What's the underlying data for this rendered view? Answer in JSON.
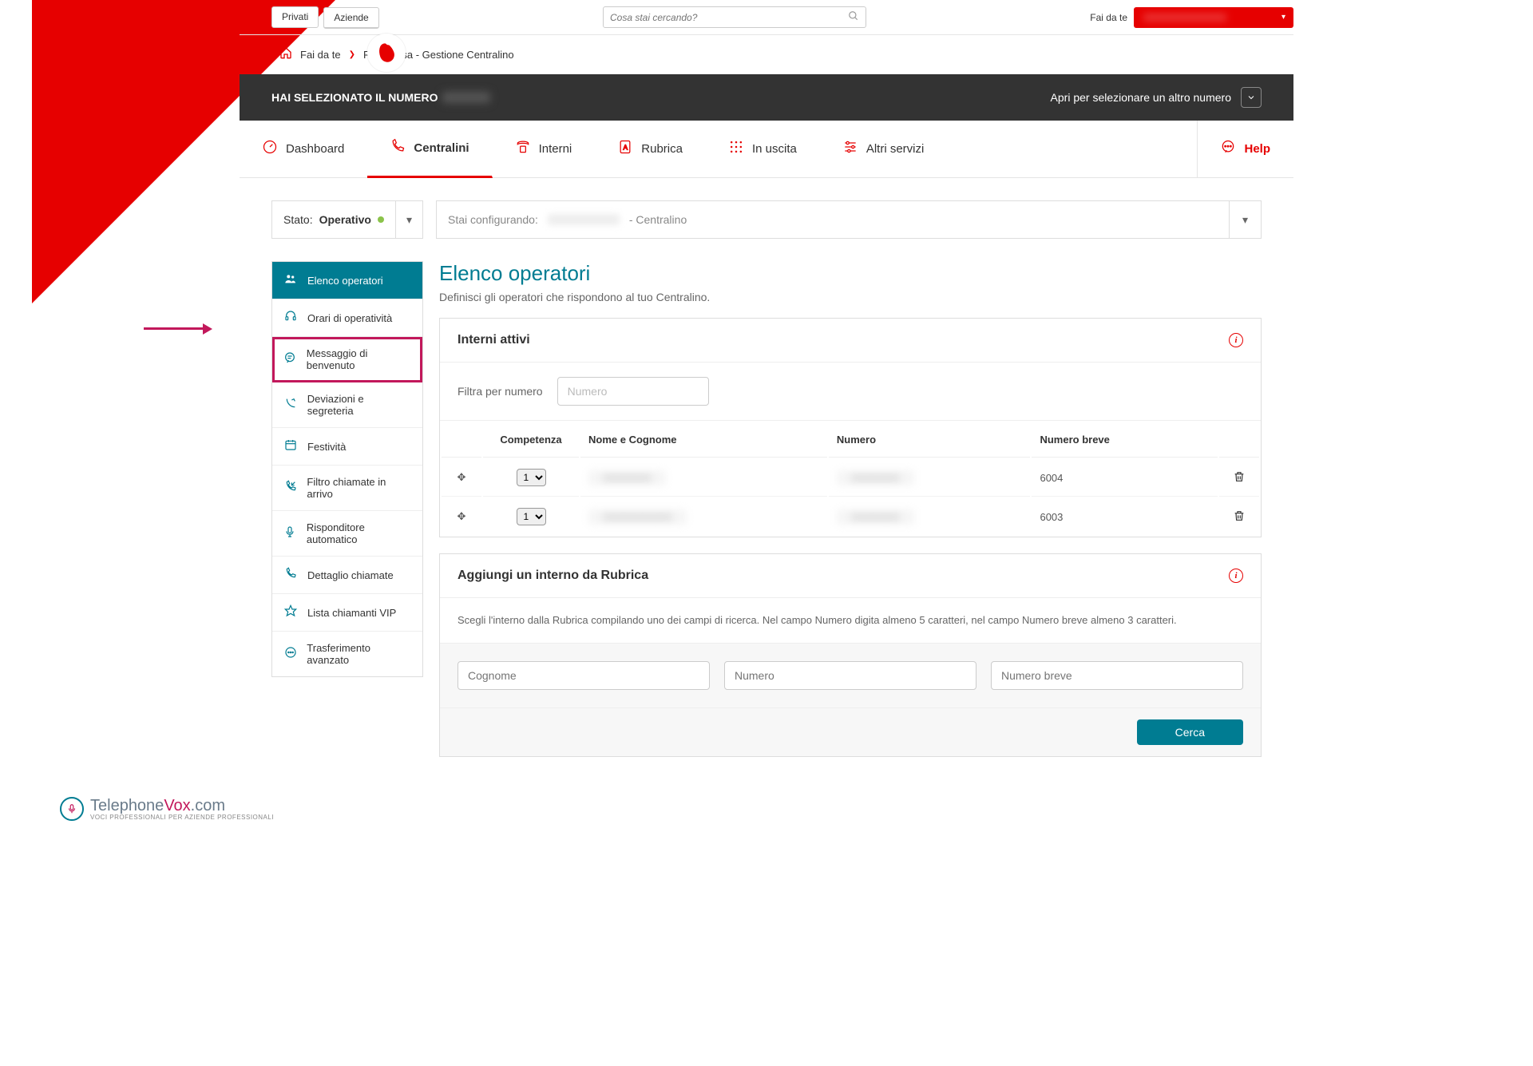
{
  "topbar": {
    "tab_privati": "Privati",
    "tab_aziende": "Aziende",
    "search_placeholder": "Cosa stai cercando?",
    "faidate_label": "Fai da te"
  },
  "breadcrumb": {
    "home": "Fai da te",
    "page": "Rete Fissa - Gestione Centralino"
  },
  "darkstrip": {
    "selected_label": "HAI SELEZIONATO IL NUMERO",
    "open_other": "Apri per selezionare un altro numero"
  },
  "mainnav": {
    "dashboard": "Dashboard",
    "centralini": "Centralini",
    "interni": "Interni",
    "rubrica": "Rubrica",
    "inuscita": "In uscita",
    "altri": "Altri servizi",
    "help": "Help"
  },
  "status": {
    "stato_label": "Stato:",
    "stato_value": "Operativo",
    "config_label": "Stai configurando:",
    "config_suffix": "- Centralino"
  },
  "sidebar": {
    "items": [
      "Elenco operatori",
      "Orari di operatività",
      "Messaggio di benvenuto",
      "Deviazioni e segreteria",
      "Festività",
      "Filtro chiamate in arrivo",
      "Risponditore automatico",
      "Dettaglio chiamate",
      "Lista chiamanti VIP",
      "Trasferimento avanzato"
    ]
  },
  "main": {
    "title": "Elenco operatori",
    "subtitle": "Definisci gli operatori che rispondono al tuo Centralino."
  },
  "interni_attivi": {
    "title": "Interni attivi",
    "filter_label": "Filtra per numero",
    "filter_placeholder": "Numero",
    "columns": {
      "competenza": "Competenza",
      "nome": "Nome e Cognome",
      "numero": "Numero",
      "breve": "Numero breve"
    },
    "rows": [
      {
        "competenza": "1",
        "breve": "6004"
      },
      {
        "competenza": "1",
        "breve": "6003"
      }
    ]
  },
  "aggiungi": {
    "title": "Aggiungi un interno da Rubrica",
    "desc": "Scegli l'interno dalla Rubrica compilando uno dei campi di ricerca. Nel campo Numero digita almeno 5 caratteri, nel campo Numero breve almeno 3 caratteri.",
    "ph_cognome": "Cognome",
    "ph_numero": "Numero",
    "ph_breve": "Numero breve",
    "btn": "Cerca"
  },
  "tvox": {
    "brand_a": "Telephone",
    "brand_b": "Vox",
    "brand_c": ".com",
    "sub": "VOCI PROFESSIONALI PER AZIENDE PROFESSIONALI"
  }
}
